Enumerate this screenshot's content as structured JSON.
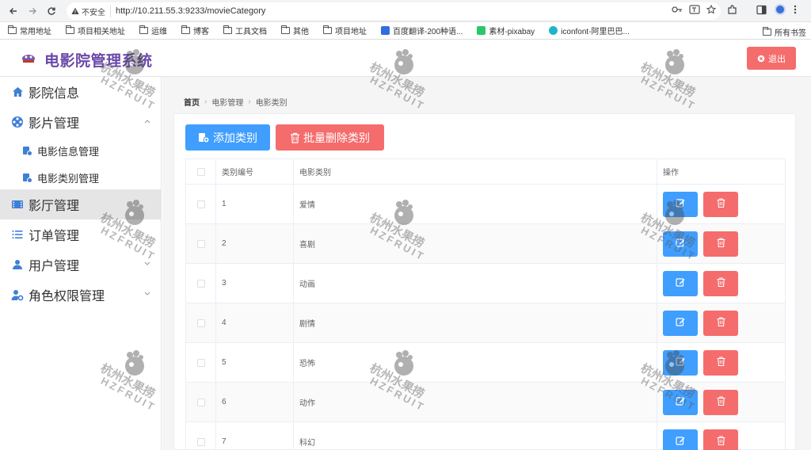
{
  "browser": {
    "security_label": "不安全",
    "url": "http://10.211.55.3:9233/movieCategory",
    "bookmarks": [
      "常用地址",
      "项目相关地址",
      "运维",
      "博客",
      "工具文档",
      "其他",
      "项目地址",
      "百度翻译-200种语...",
      "素材-pixabay",
      "iconfont-阿里巴巴..."
    ],
    "bookmarks_right": "所有书签"
  },
  "header": {
    "title": "电影院管理系统",
    "logout_label": "退出"
  },
  "sidebar": {
    "items": [
      {
        "label": "影院信息",
        "icon": "home-icon"
      },
      {
        "label": "影片管理",
        "icon": "film-reel-icon",
        "expanded": true
      },
      {
        "label": "影厅管理",
        "icon": "hall-icon",
        "active": true
      },
      {
        "label": "订单管理",
        "icon": "list-icon"
      },
      {
        "label": "用户管理",
        "icon": "user-icon"
      },
      {
        "label": "角色权限管理",
        "icon": "user-setting-icon"
      }
    ],
    "sub_items": [
      {
        "label": "电影信息管理"
      },
      {
        "label": "电影类别管理"
      }
    ]
  },
  "breadcrumb": [
    "首页",
    "电影管理",
    "电影类别"
  ],
  "toolbar": {
    "add_label": "添加类别",
    "batch_delete_label": "批量删除类别"
  },
  "table": {
    "columns": [
      "类别编号",
      "电影类别",
      "操作"
    ],
    "rows": [
      {
        "id": "1",
        "name": "爱情"
      },
      {
        "id": "2",
        "name": "喜剧"
      },
      {
        "id": "3",
        "name": "动画"
      },
      {
        "id": "4",
        "name": "剧情"
      },
      {
        "id": "5",
        "name": "恐怖"
      },
      {
        "id": "6",
        "name": "动作"
      },
      {
        "id": "7",
        "name": "科幻"
      }
    ]
  },
  "watermark": {
    "cn": "杭州水果捞",
    "en": "HZFRUIT"
  },
  "colors": {
    "primary": "#409eff",
    "danger": "#f56c6c",
    "title": "#6a49a8"
  }
}
